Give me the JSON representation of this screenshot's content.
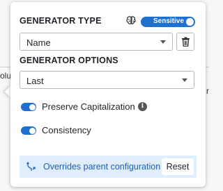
{
  "background": {
    "left_fragment": "olu",
    "right_fragment": "r"
  },
  "generator_type": {
    "heading": "GENERATOR TYPE",
    "brain_icon": "brain-icon",
    "sensitive_toggle": {
      "label": "Sensitive",
      "on": true,
      "color": "#1e6fcf"
    },
    "select_value": "Name",
    "delete_icon": "trash-icon"
  },
  "generator_options": {
    "heading": "GENERATOR OPTIONS",
    "select_value": "Last",
    "toggles": [
      {
        "label": "Preserve Capitalization",
        "on": true,
        "has_info": true
      },
      {
        "label": "Consistency",
        "on": true,
        "has_info": false
      }
    ]
  },
  "override": {
    "icon": "split-arrow-icon",
    "text": "Overrides parent configuration",
    "reset_label": "Reset",
    "background_color": "#dfeefa",
    "text_color": "#1e5fb4"
  }
}
